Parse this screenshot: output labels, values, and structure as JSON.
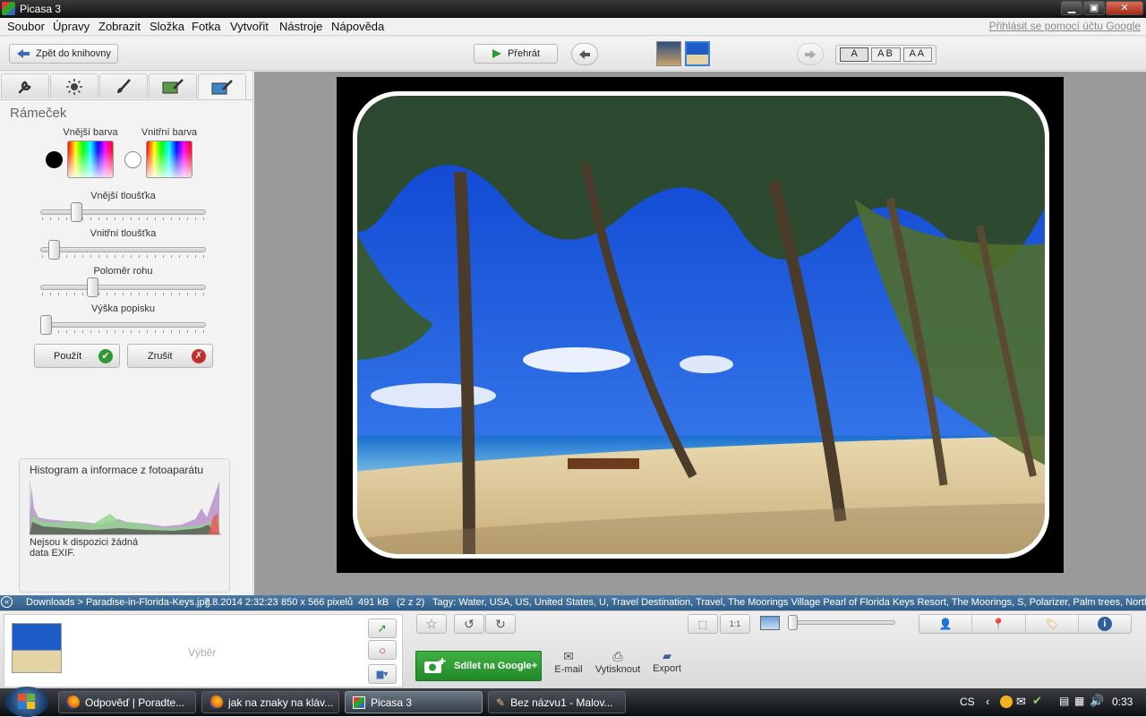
{
  "window": {
    "title": "Picasa 3"
  },
  "menu": [
    "Soubor",
    "Úpravy",
    "Zobrazit",
    "Složka",
    "Fotka",
    "Vytvořit",
    "Nástroje",
    "Nápověda"
  ],
  "google_signin": "Přihlásit se pomocí účtu Google",
  "toolbar": {
    "back_label": "Zpět do knihovny",
    "play_label": "Přehrát",
    "text_modes": [
      "A",
      "AB",
      "AA"
    ]
  },
  "panel": {
    "title": "Rámeček",
    "outer_color_label": "Vnější barva",
    "inner_color_label": "Vnitřní barva",
    "outer_color": "#000000",
    "inner_color": "#ffffff",
    "sliders": [
      {
        "label": "Vnější tloušťka",
        "value": 0.2
      },
      {
        "label": "Vnitřní tloušťka",
        "value": 0.05
      },
      {
        "label": "Poloměr rohu",
        "value": 0.3
      },
      {
        "label": "Výška popisku",
        "value": 0.0
      }
    ],
    "apply_label": "Použít",
    "cancel_label": "Zrušit"
  },
  "histogram": {
    "title": "Histogram a informace z fotoaparátu",
    "exif_line1": "Nejsou k dispozici žádná",
    "exif_line2": "data EXIF."
  },
  "status": {
    "path": "Downloads > Paradise-in-Florida-Keys.jpg",
    "date": "7.8.2014 2:32:23",
    "dimensions": "850 x 566 pixelů",
    "size": "491 kB",
    "position": "(2 z 2)",
    "tags": "Tagy: Water, USA, US, United States, U, Travel Destination, Travel, The Moorings Village Pearl of Florida Keys Resort, The Moorings, S, Polarizer, Palm trees, North America,"
  },
  "bottom": {
    "selection_label": "Výběr",
    "share_label": "Sdílet na Google+",
    "email_label": "E-mail",
    "print_label": "Vytisknout",
    "export_label": "Export"
  },
  "taskbar": {
    "tasks": [
      "Odpověď | Poradte...",
      "jak na znaky na kláv...",
      "Picasa 3",
      "Bez názvu1 - Malov..."
    ],
    "lang": "CS",
    "time": "0:33"
  },
  "colors": {
    "accent_green": "#2f9a35",
    "status_blue": "#3d6b97"
  }
}
